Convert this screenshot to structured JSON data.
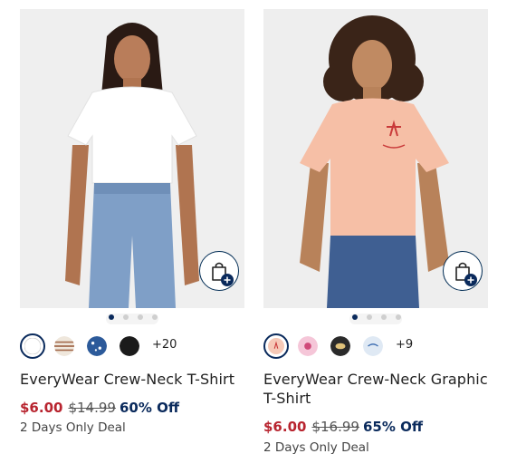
{
  "products": [
    {
      "name": "EveryWear Crew-Neck T-Shirt",
      "sale_price": "$6.00",
      "original_price": "$14.99",
      "discount": "60% Off",
      "deal_text": "2 Days Only Deal",
      "more_swatches": "+20",
      "swatch_colors": [
        "#ffffff",
        "#e8dfd4",
        "#2c5a9a",
        "#1b1b1b"
      ],
      "carousel_active_index": 0,
      "carousel_dot_count": 4
    },
    {
      "name": "EveryWear Crew-Neck Graphic T-Shirt",
      "sale_price": "$6.00",
      "original_price": "$16.99",
      "discount": "65% Off",
      "deal_text": "2 Days Only Deal",
      "more_swatches": "+9",
      "swatch_colors": [
        "#f6c9b7",
        "#f5c6d8",
        "#2a2a2a",
        "#dfe9f4"
      ],
      "carousel_active_index": 0,
      "carousel_dot_count": 4
    }
  ],
  "icons": {
    "add_to_bag": "shopping-bag-plus-icon"
  },
  "colors": {
    "sale": "#b8242f",
    "discount": "#0a2a5c",
    "accent": "#002c54"
  }
}
